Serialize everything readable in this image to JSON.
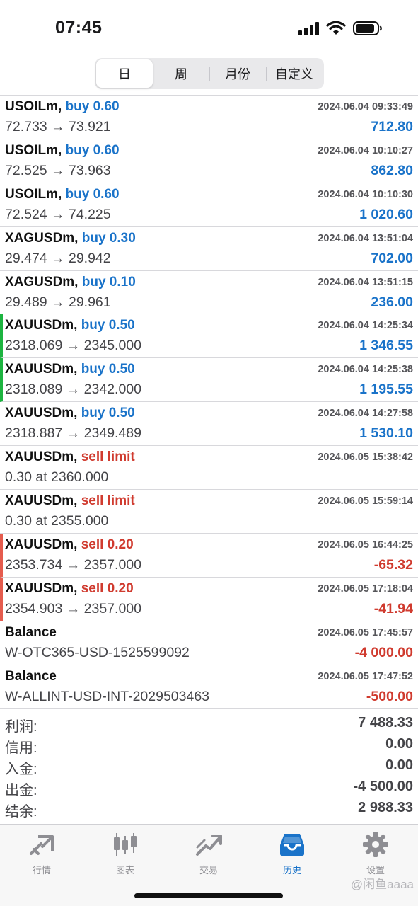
{
  "status_bar": {
    "time": "07:45"
  },
  "segments": [
    {
      "label": "日",
      "active": true
    },
    {
      "label": "周",
      "active": false
    },
    {
      "label": "月份",
      "active": false
    },
    {
      "label": "自定义",
      "active": false
    }
  ],
  "rows": [
    {
      "symbol": "USOILm,",
      "type": "buy 0.60",
      "side": "buy",
      "date": "2024.06.04 09:33:49",
      "prices": "72.733 → 73.921",
      "profit": "712.80",
      "sign": "pos",
      "mark": ""
    },
    {
      "symbol": "USOILm,",
      "type": "buy 0.60",
      "side": "buy",
      "date": "2024.06.04 10:10:27",
      "prices": "72.525 → 73.963",
      "profit": "862.80",
      "sign": "pos",
      "mark": ""
    },
    {
      "symbol": "USOILm,",
      "type": "buy 0.60",
      "side": "buy",
      "date": "2024.06.04 10:10:30",
      "prices": "72.524 → 74.225",
      "profit": "1 020.60",
      "sign": "pos",
      "mark": ""
    },
    {
      "symbol": "XAGUSDm,",
      "type": "buy 0.30",
      "side": "buy",
      "date": "2024.06.04 13:51:04",
      "prices": "29.474 → 29.942",
      "profit": "702.00",
      "sign": "pos",
      "mark": ""
    },
    {
      "symbol": "XAGUSDm,",
      "type": "buy 0.10",
      "side": "buy",
      "date": "2024.06.04 13:51:15",
      "prices": "29.489 → 29.961",
      "profit": "236.00",
      "sign": "pos",
      "mark": ""
    },
    {
      "symbol": "XAUUSDm,",
      "type": "buy 0.50",
      "side": "buy",
      "date": "2024.06.04 14:25:34",
      "prices": "2318.069 → 2345.000",
      "profit": "1 346.55",
      "sign": "pos",
      "mark": "green"
    },
    {
      "symbol": "XAUUSDm,",
      "type": "buy 0.50",
      "side": "buy",
      "date": "2024.06.04 14:25:38",
      "prices": "2318.089 → 2342.000",
      "profit": "1 195.55",
      "sign": "pos",
      "mark": "green"
    },
    {
      "symbol": "XAUUSDm,",
      "type": "buy 0.50",
      "side": "buy",
      "date": "2024.06.04 14:27:58",
      "prices": "2318.887 → 2349.489",
      "profit": "1 530.10",
      "sign": "pos",
      "mark": ""
    },
    {
      "symbol": "XAUUSDm,",
      "type": "sell limit",
      "side": "sell",
      "date": "2024.06.05 15:38:42",
      "prices": "0.30 at 2360.000",
      "profit": "",
      "sign": "pos",
      "mark": ""
    },
    {
      "symbol": "XAUUSDm,",
      "type": "sell limit",
      "side": "sell",
      "date": "2024.06.05 15:59:14",
      "prices": "0.30 at 2355.000",
      "profit": "",
      "sign": "pos",
      "mark": ""
    },
    {
      "symbol": "XAUUSDm,",
      "type": "sell 0.20",
      "side": "sell",
      "date": "2024.06.05 16:44:25",
      "prices": "2353.734 → 2357.000",
      "profit": "-65.32",
      "sign": "neg",
      "mark": "red"
    },
    {
      "symbol": "XAUUSDm,",
      "type": "sell 0.20",
      "side": "sell",
      "date": "2024.06.05 17:18:04",
      "prices": "2354.903 → 2357.000",
      "profit": "-41.94",
      "sign": "neg",
      "mark": "red"
    },
    {
      "symbol": "Balance",
      "type": "",
      "side": "",
      "date": "2024.06.05 17:45:57",
      "prices": "W-OTC365-USD-1525599092",
      "profit": "-4 000.00",
      "sign": "neg",
      "mark": ""
    },
    {
      "symbol": "Balance",
      "type": "",
      "side": "",
      "date": "2024.06.05 17:47:52",
      "prices": "W-ALLINT-USD-INT-2029503463",
      "profit": "-500.00",
      "sign": "neg",
      "mark": ""
    }
  ],
  "summary": [
    {
      "label": "利润:",
      "value": "7 488.33"
    },
    {
      "label": "信用:",
      "value": "0.00"
    },
    {
      "label": "入金:",
      "value": "0.00"
    },
    {
      "label": "出金:",
      "value": "-4 500.00"
    },
    {
      "label": "结余:",
      "value": "2 988.33"
    }
  ],
  "tabs": [
    {
      "label": "行情",
      "icon": "quotes-icon",
      "active": false
    },
    {
      "label": "图表",
      "icon": "chart-icon",
      "active": false
    },
    {
      "label": "交易",
      "icon": "trade-icon",
      "active": false
    },
    {
      "label": "历史",
      "icon": "history-icon",
      "active": true
    },
    {
      "label": "设置",
      "icon": "settings-icon",
      "active": false
    }
  ],
  "watermark": "@闲鱼aaaa",
  "colors": {
    "buy": "#1a73c9",
    "sell": "#d03b2f",
    "active_tab": "#1a73c9",
    "inactive_tab": "#8e8e93",
    "mark_green": "#1db440",
    "mark_red": "#e55c4e"
  }
}
